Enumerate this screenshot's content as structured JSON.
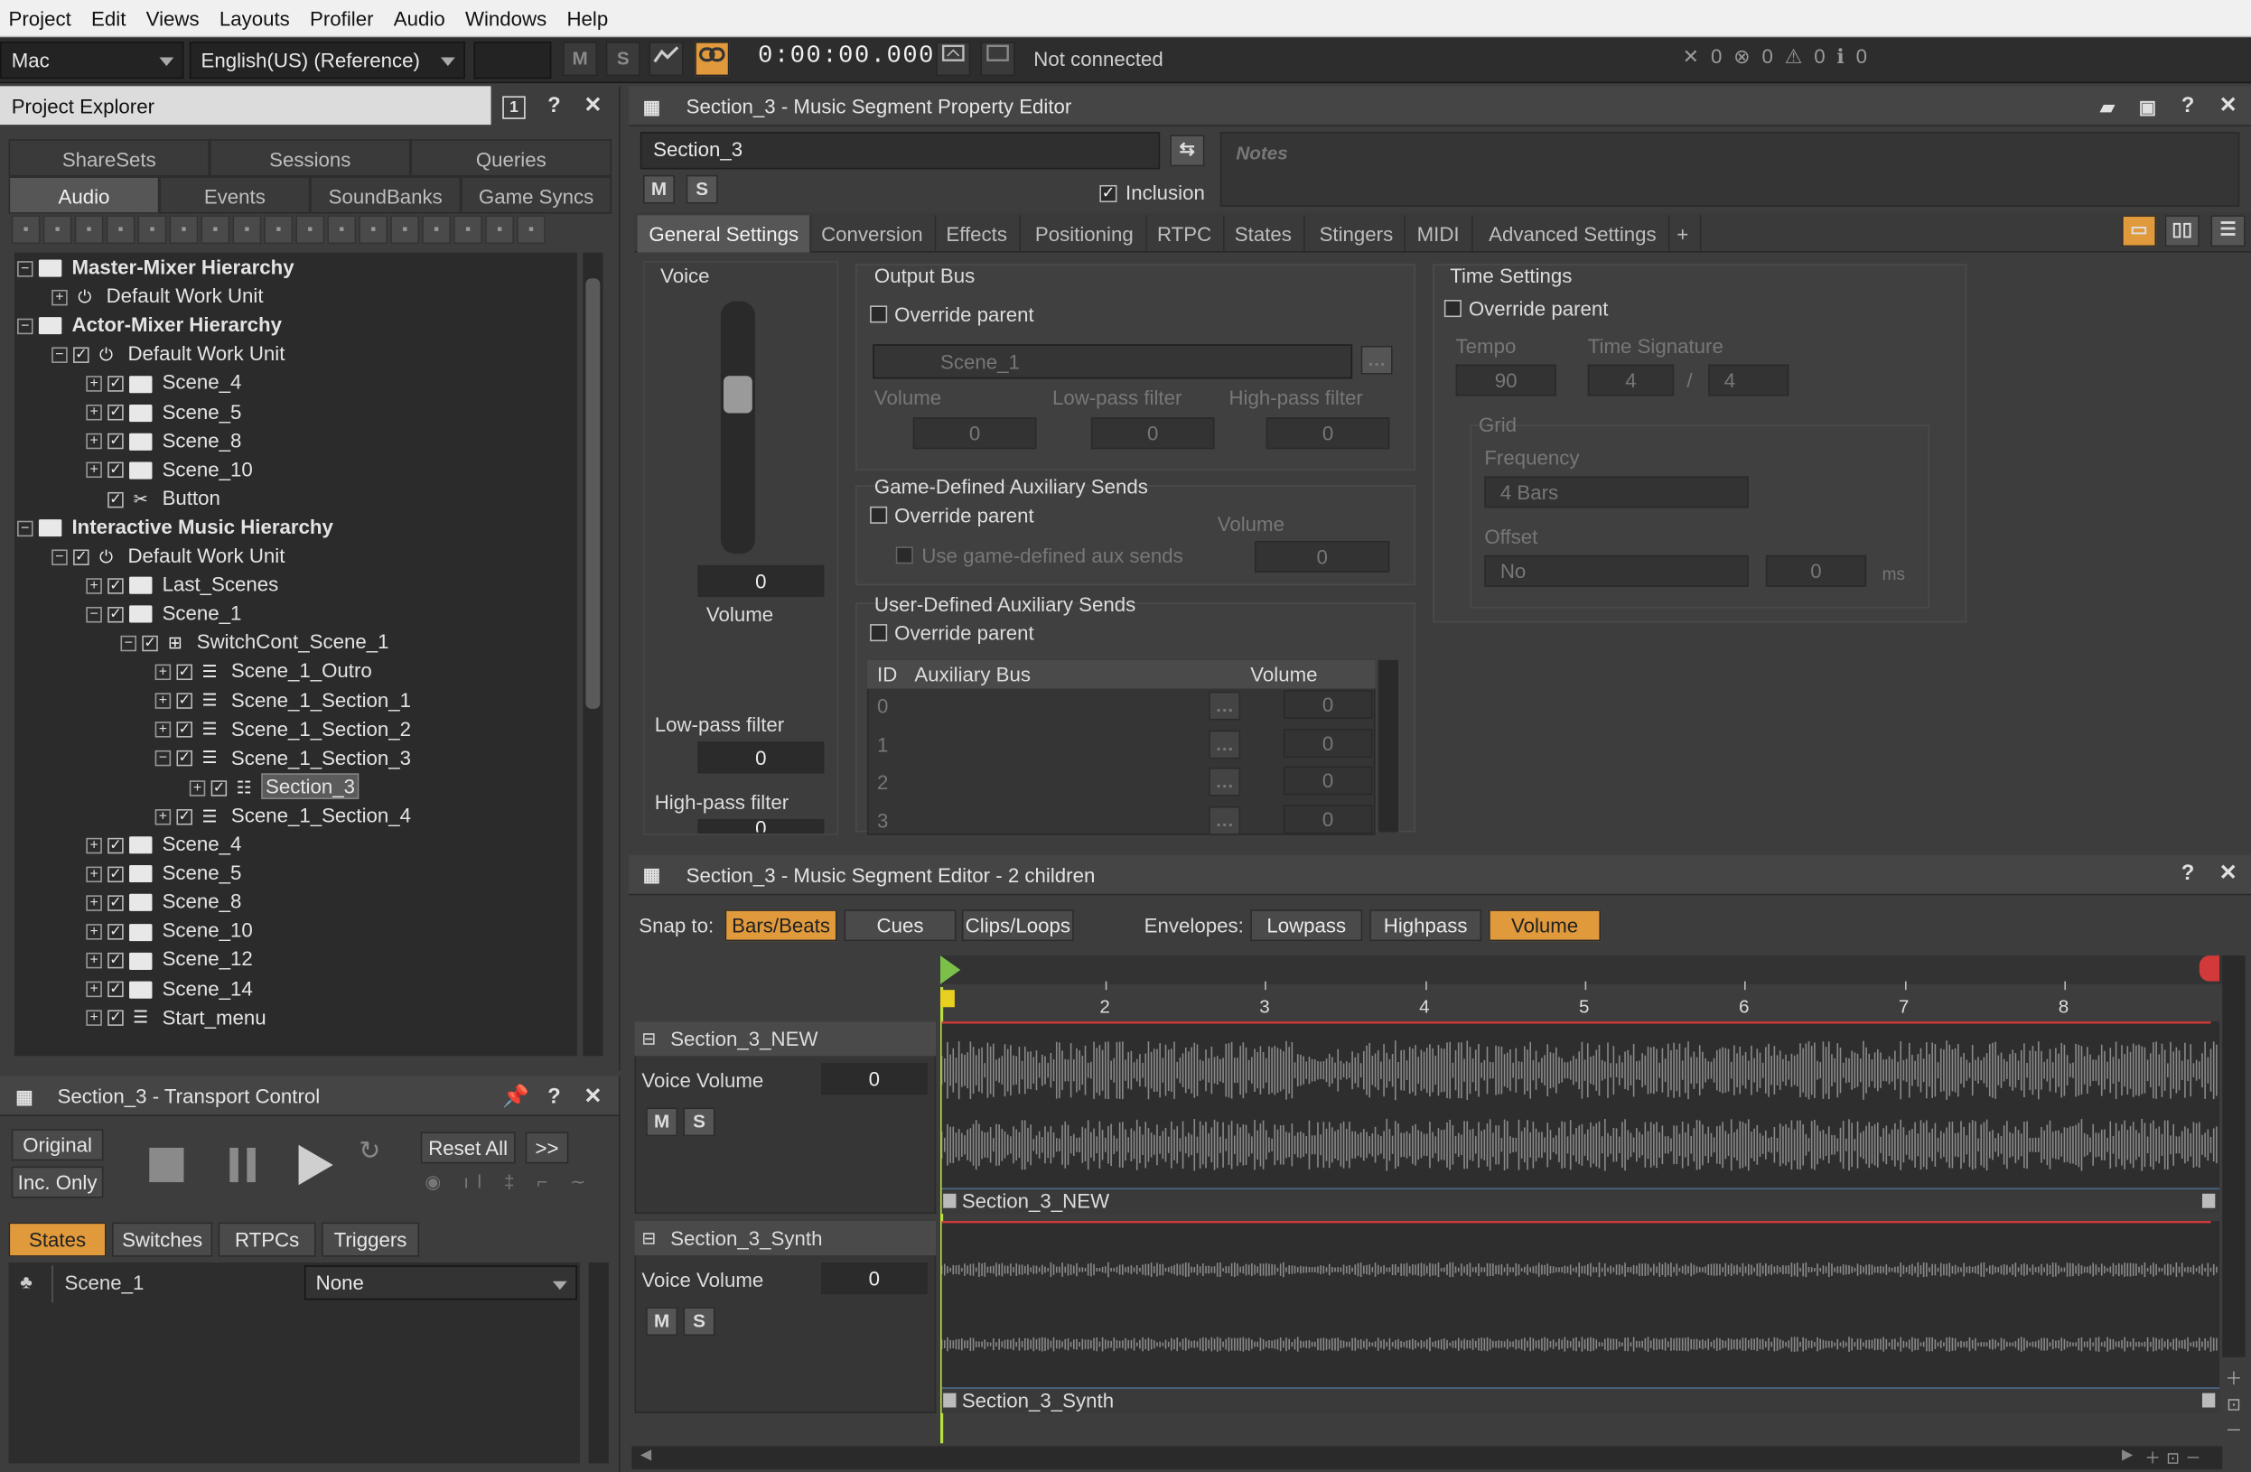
{
  "menu": [
    "Project",
    "Edit",
    "Views",
    "Layouts",
    "Profiler",
    "Audio",
    "Windows",
    "Help"
  ],
  "toolbar": {
    "platform": "Mac",
    "language": "English(US) (Reference)",
    "mute_label": "M",
    "solo_label": "S",
    "timecode": "0:00:00.000",
    "connection_status": "Not connected",
    "counts": {
      "errors_x": "0",
      "errors": "0",
      "warnings": "0",
      "messages": "0"
    }
  },
  "project_explorer": {
    "title": "Project Explorer",
    "tabs_top": [
      "ShareSets",
      "Sessions",
      "Queries"
    ],
    "tabs_bottom": [
      "Audio",
      "Events",
      "SoundBanks",
      "Game Syncs"
    ],
    "active_tab": "Audio",
    "tree": [
      {
        "label": "Master-Mixer Hierarchy",
        "level": 0,
        "icon": "folder",
        "bold": true,
        "exp": "−",
        "chk": false
      },
      {
        "label": "Default Work Unit",
        "level": 1,
        "icon": "workunit",
        "exp": "+",
        "chk": false
      },
      {
        "label": "Actor-Mixer Hierarchy",
        "level": 0,
        "icon": "folder",
        "bold": true,
        "exp": "−",
        "chk": false
      },
      {
        "label": "Default Work Unit",
        "level": 1,
        "icon": "workunit",
        "exp": "−",
        "chk": true
      },
      {
        "label": "Scene_4",
        "level": 2,
        "icon": "folder",
        "exp": "+",
        "chk": true
      },
      {
        "label": "Scene_5",
        "level": 2,
        "icon": "folder",
        "exp": "+",
        "chk": true
      },
      {
        "label": "Scene_8",
        "level": 2,
        "icon": "folder",
        "exp": "+",
        "chk": true
      },
      {
        "label": "Scene_10",
        "level": 2,
        "icon": "folder",
        "exp": "+",
        "chk": true
      },
      {
        "label": "Button",
        "level": 2,
        "icon": "sound",
        "exp": "",
        "chk": true
      },
      {
        "label": "Interactive Music Hierarchy",
        "level": 0,
        "icon": "folder",
        "bold": true,
        "exp": "−",
        "chk": false
      },
      {
        "label": "Default Work Unit",
        "level": 1,
        "icon": "workunit",
        "exp": "−",
        "chk": true
      },
      {
        "label": "Last_Scenes",
        "level": 2,
        "icon": "folder",
        "exp": "+",
        "chk": true
      },
      {
        "label": "Scene_1",
        "level": 2,
        "icon": "folder",
        "exp": "−",
        "chk": true
      },
      {
        "label": "SwitchCont_Scene_1",
        "level": 3,
        "icon": "switch",
        "exp": "−",
        "chk": true
      },
      {
        "label": "Scene_1_Outro",
        "level": 4,
        "icon": "playlist",
        "exp": "+",
        "chk": true
      },
      {
        "label": "Scene_1_Section_1",
        "level": 4,
        "icon": "playlist",
        "exp": "+",
        "chk": true
      },
      {
        "label": "Scene_1_Section_2",
        "level": 4,
        "icon": "playlist",
        "exp": "+",
        "chk": true
      },
      {
        "label": "Scene_1_Section_3",
        "level": 4,
        "icon": "playlist",
        "exp": "−",
        "chk": true
      },
      {
        "label": "Section_3",
        "level": 5,
        "icon": "segment",
        "exp": "+",
        "chk": true,
        "selected": true
      },
      {
        "label": "Scene_1_Section_4",
        "level": 4,
        "icon": "playlist",
        "exp": "+",
        "chk": true
      },
      {
        "label": "Scene_4",
        "level": 2,
        "icon": "folder",
        "exp": "+",
        "chk": true
      },
      {
        "label": "Scene_5",
        "level": 2,
        "icon": "folder",
        "exp": "+",
        "chk": true
      },
      {
        "label": "Scene_8",
        "level": 2,
        "icon": "folder",
        "exp": "+",
        "chk": true
      },
      {
        "label": "Scene_10",
        "level": 2,
        "icon": "folder",
        "exp": "+",
        "chk": true
      },
      {
        "label": "Scene_12",
        "level": 2,
        "icon": "folder",
        "exp": "+",
        "chk": true
      },
      {
        "label": "Scene_14",
        "level": 2,
        "icon": "folder",
        "exp": "+",
        "chk": true
      },
      {
        "label": "Start_menu",
        "level": 2,
        "icon": "playlist",
        "exp": "+",
        "chk": true
      }
    ]
  },
  "transport": {
    "title": "Section_3 - Transport Control",
    "original_label": "Original",
    "inc_only_label": "Inc. Only",
    "reset_all_label": "Reset All",
    "more_label": ">>",
    "tabs": [
      "States",
      "Switches",
      "RTPCs",
      "Triggers"
    ],
    "active_tab": "States",
    "state_group": "Scene_1",
    "state_value": "None"
  },
  "property_editor": {
    "title": "Section_3 - Music Segment Property Editor",
    "name": "Section_3",
    "notes_placeholder": "Notes",
    "inclusion_label": "Inclusion",
    "tabs": [
      "General Settings",
      "Conversion",
      "Effects",
      "Positioning",
      "RTPC",
      "States",
      "Stingers",
      "MIDI",
      "Advanced Settings",
      "+"
    ],
    "active_tab": "General Settings",
    "voice": {
      "title": "Voice",
      "volume_value": "0",
      "volume_label": "Volume",
      "lowpass_label": "Low-pass filter",
      "lowpass_value": "0",
      "highpass_label": "High-pass filter",
      "highpass_value": "0"
    },
    "output_bus": {
      "title": "Output Bus",
      "override_label": "Override parent",
      "bus_name": "Scene_1",
      "volume_label": "Volume",
      "lowpass_label": "Low-pass filter",
      "highpass_label": "High-pass filter",
      "volume_value": "0",
      "lowpass_value": "0",
      "highpass_value": "0"
    },
    "game_aux": {
      "title": "Game-Defined Auxiliary Sends",
      "override_label": "Override parent",
      "use_label": "Use game-defined aux sends",
      "volume_label": "Volume",
      "volume_value": "0"
    },
    "user_aux": {
      "title": "User-Defined Auxiliary Sends",
      "override_label": "Override parent",
      "col_id": "ID",
      "col_bus": "Auxiliary Bus",
      "col_volume": "Volume",
      "rows": [
        {
          "id": "0",
          "vol": "0"
        },
        {
          "id": "1",
          "vol": "0"
        },
        {
          "id": "2",
          "vol": "0"
        },
        {
          "id": "3",
          "vol": "0"
        }
      ]
    },
    "time": {
      "title": "Time Settings",
      "override_label": "Override parent",
      "tempo_label": "Tempo",
      "tempo_value": "90",
      "timesig_label": "Time Signature",
      "timesig_num": "4",
      "timesig_sep": "/",
      "timesig_den": "4",
      "grid_label": "Grid",
      "freq_label": "Frequency",
      "freq_value": "4 Bars",
      "offset_label": "Offset",
      "offset_value": "No",
      "offset_ms": "0",
      "ms_label": "ms"
    }
  },
  "segment_editor": {
    "title": "Section_3 - Music Segment Editor - 2 children",
    "snap_label": "Snap to:",
    "snap_buttons": [
      {
        "label": "Bars/Beats",
        "on": true
      },
      {
        "label": "Cues",
        "on": false
      },
      {
        "label": "Clips/Loops",
        "on": false
      }
    ],
    "env_label": "Envelopes:",
    "env_buttons": [
      {
        "label": "Lowpass",
        "on": false
      },
      {
        "label": "Highpass",
        "on": false
      },
      {
        "label": "Volume",
        "on": true
      }
    ],
    "ruler": [
      "2",
      "3",
      "4",
      "5",
      "6",
      "7",
      "8"
    ],
    "tracks": [
      {
        "name": "Section_3_NEW",
        "voice_label": "Voice Volume",
        "volume": "0",
        "clip": "Section_3_NEW"
      },
      {
        "name": "Section_3_Synth",
        "voice_label": "Voice Volume",
        "volume": "0",
        "clip": "Section_3_Synth"
      }
    ]
  },
  "colors": {
    "accent": "#e09a3c",
    "red_line": "#d23a3a",
    "cue_green": "#7cc04a",
    "clip_bar": "#4a6a8a"
  }
}
